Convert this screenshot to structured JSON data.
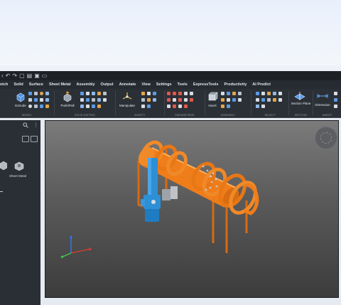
{
  "menubar": {
    "items": [
      "etch",
      "Solid",
      "Surface",
      "Sheet Metal",
      "Assembly",
      "Output",
      "Annotate",
      "View",
      "Settings",
      "Tools",
      "ExpressTools",
      "Productivity",
      "AI Predict"
    ]
  },
  "ribbon": {
    "groups": [
      {
        "label": "MODEL",
        "button": "Extrude"
      },
      {
        "label": "SOLID EDITING",
        "button": "Push/Pull"
      },
      {
        "label": "MODIFY",
        "button": "Manipulate"
      },
      {
        "label": "PARAMETRIZE",
        "button": ""
      },
      {
        "label": "ASSEMBLY",
        "button": "Insert"
      },
      {
        "label": "SELECT",
        "button": ""
      },
      {
        "label": "SECTION",
        "button": "Section Plane"
      },
      {
        "label": "ANNOT",
        "button": "Dimension"
      }
    ]
  },
  "sidebar": {
    "search_icon": "search-icon",
    "menu_icon": "kebab-menu-icon",
    "items": [
      {
        "label": "",
        "icon": "part-icon"
      },
      {
        "label": "Sheet Metal",
        "icon": "sheet-metal-icon"
      }
    ]
  },
  "viewport": {
    "axis_colors": {
      "x": "#e23b2e",
      "y": "#3fd04a",
      "z": "#2f7bff"
    },
    "model_colors": {
      "pipe": "#ef7d1a",
      "valve": "#2d8fd6"
    }
  }
}
